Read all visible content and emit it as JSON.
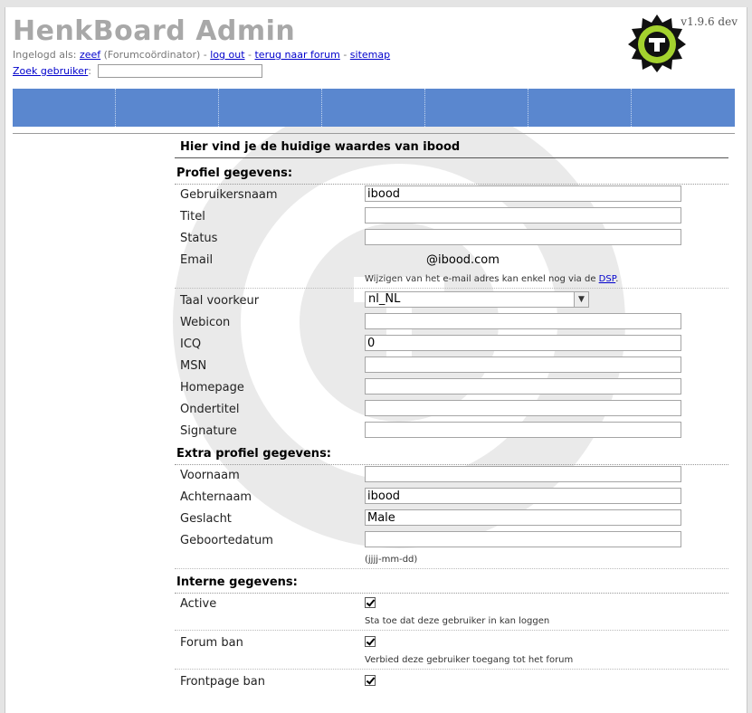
{
  "header": {
    "app_title": "HenkBoard Admin",
    "version": "v1.9.6 dev",
    "logged_in_prefix": "Ingelogd als:",
    "user_name": "zeef",
    "user_role": "(Forumcoördinator)",
    "sep": " - ",
    "logout": "log out",
    "back_to_forum": "terug naar forum",
    "sitemap": "sitemap",
    "search_user_link": "Zoek gebruiker",
    "search_colon": ":",
    "search_value": ""
  },
  "nav": {
    "cells": 7,
    "bar_color": "#5a87cf"
  },
  "main": {
    "heading": "Hier vind je de huidige waardes van ibood",
    "profile_section": "Profiel gegevens:",
    "username_label": "Gebruikersnaam",
    "username_value": "ibood",
    "title_label": "Titel",
    "title_value": "",
    "status_label": "Status",
    "status_value": "",
    "email_label": "Email",
    "email_value": "@ibood.com",
    "email_note": "Wijzigen van het e-mail adres kan enkel nog via de",
    "email_note_link": "DSP",
    "email_note_end": ".",
    "lang_label": "Taal voorkeur",
    "lang_value": "nl_NL",
    "webicon_label": "Webicon",
    "webicon_value": "",
    "icq_label": "ICQ",
    "icq_value": "0",
    "msn_label": "MSN",
    "msn_value": "",
    "homepage_label": "Homepage",
    "homepage_value": "",
    "subtitle_label": "Ondertitel",
    "subtitle_value": "",
    "signature_label": "Signature",
    "signature_value": "",
    "extra_section": "Extra profiel gegevens:",
    "firstname_label": "Voornaam",
    "firstname_value": "",
    "lastname_label": "Achternaam",
    "lastname_value": "ibood",
    "gender_label": "Geslacht",
    "gender_value": "Male",
    "birthdate_label": "Geboortedatum",
    "birthdate_value": "",
    "birthdate_note": "(jjjj-mm-dd)",
    "internal_section": "Interne gegevens:",
    "active_label": "Active",
    "active_note": "Sta toe dat deze gebruiker in kan loggen",
    "forumban_label": "Forum ban",
    "forumban_note": "Verbied deze gebruiker toegang tot het forum",
    "frontban_label": "Frontpage ban"
  },
  "colors": {
    "accent": "#5a87cf",
    "link": "#0000cc",
    "logo_green": "#a4d22e"
  }
}
